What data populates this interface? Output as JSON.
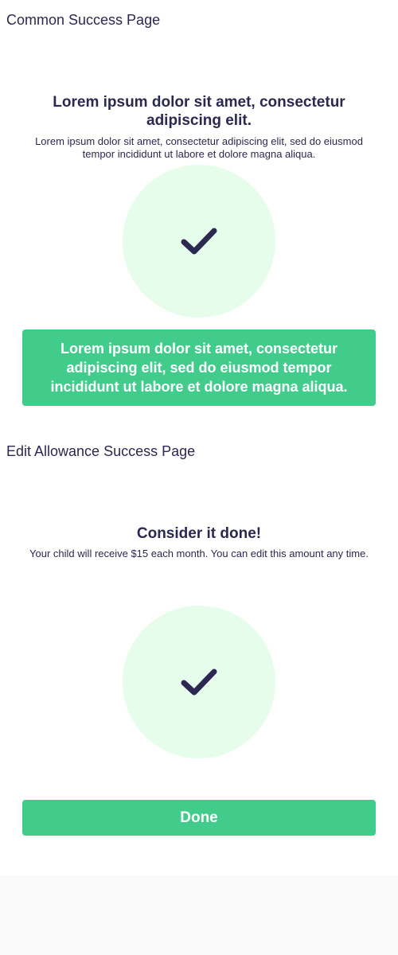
{
  "colors": {
    "text": "#2b2851",
    "accent_green": "#41cc8b",
    "circle_bg": "#e6fdec",
    "check": "#2b2851",
    "footer_bg": "#f9f9f9"
  },
  "common_success": {
    "section_label": "Common Success Page",
    "heading": "Lorem ipsum dolor sit amet, consectetur adipiscing elit.",
    "subtext": "Lorem ipsum dolor sit amet, consectetur adipiscing elit, sed do eiusmod tempor incididunt ut labore et dolore magna aliqua.",
    "icon": "checkmark-icon",
    "button_label": "Lorem ipsum dolor sit amet, consectetur adipiscing elit, sed do eiusmod tempor incididunt ut labore et dolore magna aliqua."
  },
  "edit_allowance_success": {
    "section_label": "Edit Allowance Success Page",
    "heading": "Consider it done!",
    "subtext": "Your child will receive $15 each month. You can edit this amount any time.",
    "icon": "checkmark-icon",
    "button_label": "Done"
  }
}
